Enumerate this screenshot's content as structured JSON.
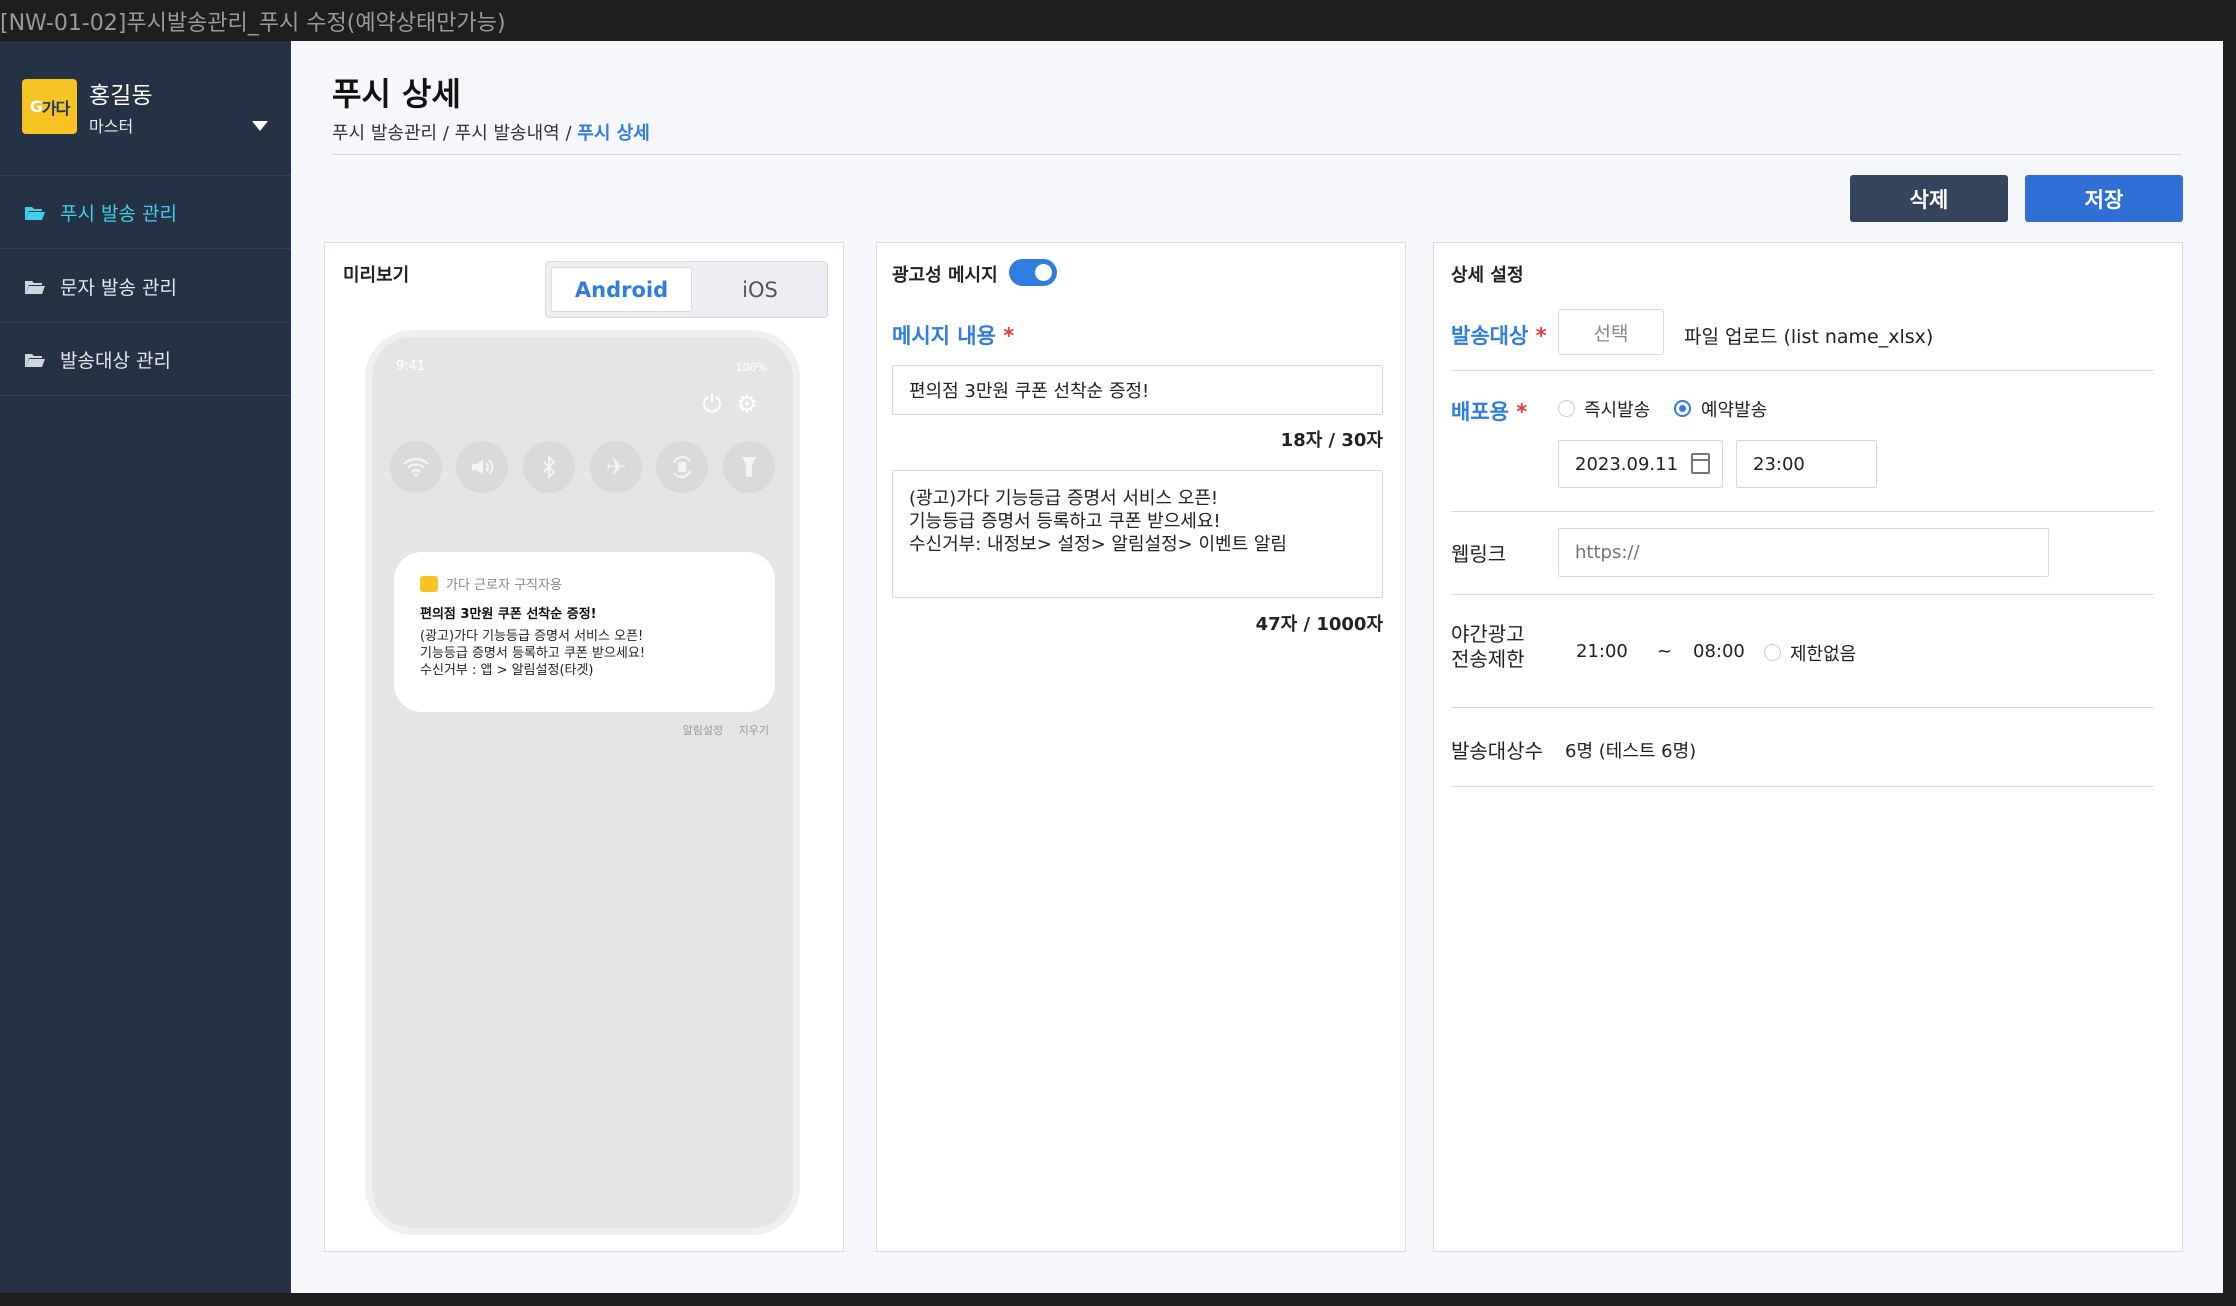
{
  "window": {
    "title": "[NW-01-02]푸시발송관리_푸시 수정(예약상태만가능)"
  },
  "sidebar": {
    "logo_text": "G가다",
    "user_name": "홍길동",
    "user_role": "마스터",
    "items": [
      {
        "label": "푸시 발송 관리",
        "active": true
      },
      {
        "label": "문자 발송 관리",
        "active": false
      },
      {
        "label": "발송대상 관리",
        "active": false
      }
    ]
  },
  "header": {
    "title": "푸시 상세",
    "breadcrumb": [
      "푸시 발송관리",
      "푸시 발송내역",
      "푸시 상세"
    ],
    "separator": "/"
  },
  "actions": {
    "delete_label": "삭제",
    "save_label": "저장"
  },
  "preview": {
    "label": "미리보기",
    "tabs": {
      "android": "Android",
      "ios": "iOS"
    },
    "selected_tab": "Android",
    "phone": {
      "time": "9:41",
      "battery": "100%",
      "notification": {
        "app": "가다 근로자 구직자용",
        "title": "편의점 3만원 쿠폰 선착순 증정!",
        "body": "(광고)가다 기능등급 증명서 서비스 오픈!\n기능등급 증명서 등록하고 쿠폰 받으세요!\n수신거부 : 앱 > 알림설정(타겟)"
      },
      "actions": {
        "settings": "알림설정",
        "clear": "지우기"
      }
    }
  },
  "message": {
    "ad_label": "광고성 메시지",
    "ad_toggle_on": true,
    "content_label": "메시지 내용",
    "title_value": "편의점 3만원 쿠폰 선착순 증정!",
    "title_counter": "18자 / 30자",
    "body_value": "(광고)가다 기능등급 증명서 서비스 오픈!\n기능등급 증명서 등록하고 쿠폰 받으세요!\n수신거부: 내정보> 설정> 알림설정> 이벤트 알림",
    "body_counter": "47자 / 1000자"
  },
  "detail": {
    "label": "상세 설정",
    "target": {
      "label": "발송대상",
      "select_label": "선택",
      "file_text": "파일 업로드 (list name_xlsx)"
    },
    "schedule": {
      "label": "배포용",
      "options": [
        "즉시발송",
        "예약발송"
      ],
      "selected": "예약발송",
      "date": "2023.09.11",
      "time": "23:00"
    },
    "weblink": {
      "label": "웹링크",
      "placeholder": "https://"
    },
    "night": {
      "label_line1": "야간광고",
      "label_line2": "전송제한",
      "from": "21:00",
      "tilde": "~",
      "to": "08:00",
      "unlimited_label": "제한없음"
    },
    "count": {
      "label": "발송대상수",
      "value": "6명 (테스트 6명)"
    }
  },
  "colors": {
    "accent": "#2f7de1",
    "sidebar_bg": "#253246",
    "active_nav": "#3fd0e8",
    "required": "#e53935",
    "logo": "#f7c325"
  }
}
